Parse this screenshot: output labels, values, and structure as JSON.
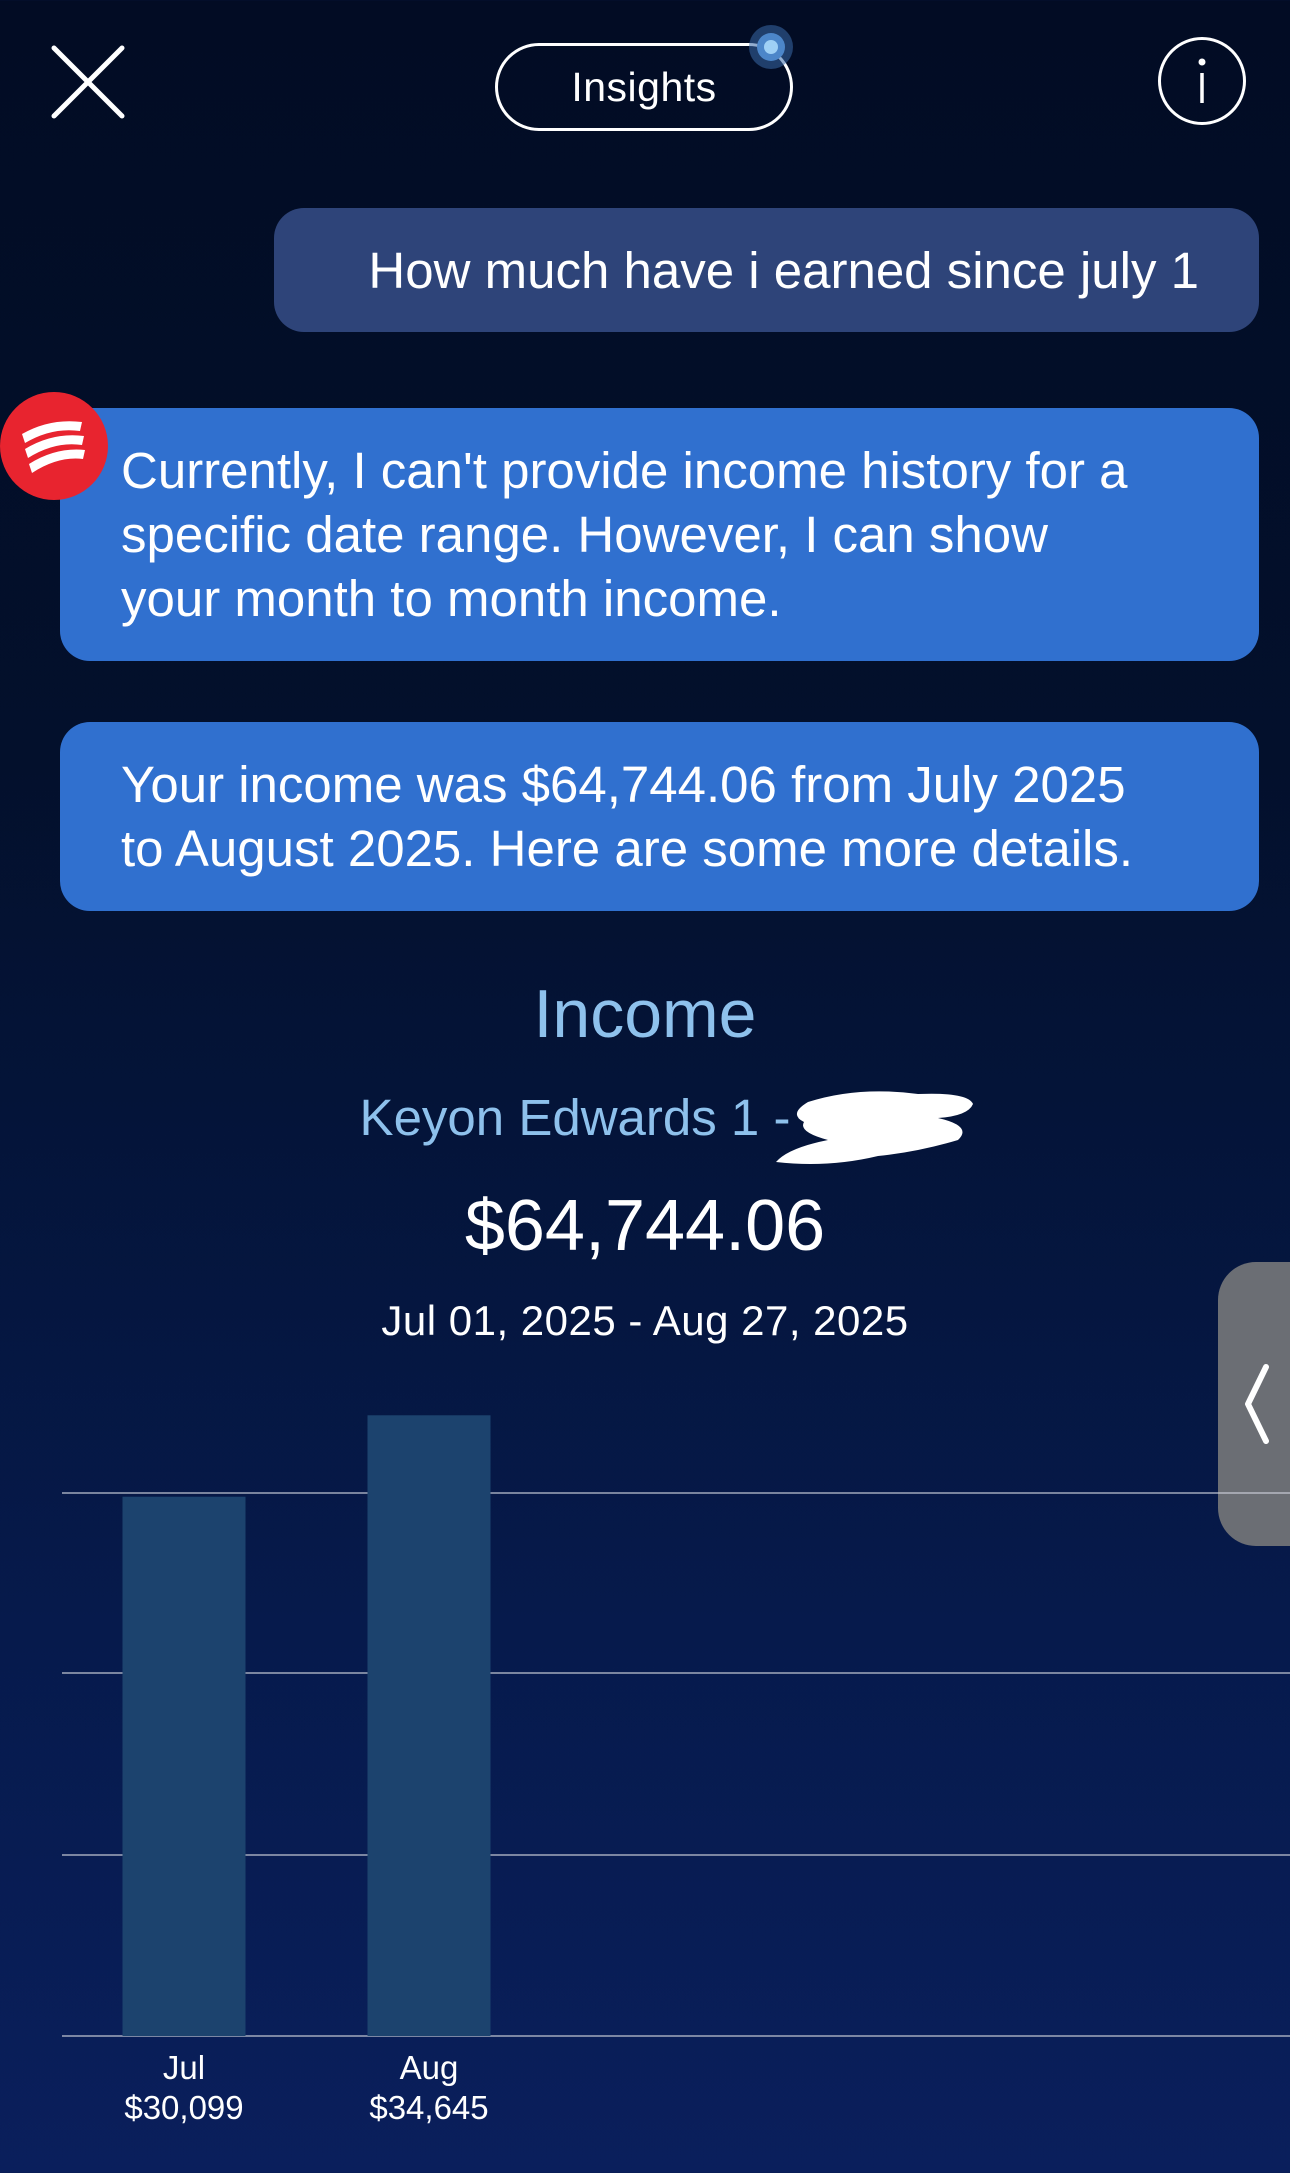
{
  "header": {
    "close_icon": "close-icon",
    "insights_label": "Insights",
    "info_icon": "info-icon"
  },
  "colors": {
    "background_top": "#020c24",
    "background_bottom": "#0a1f5c",
    "user_bubble": "#2e4479",
    "bot_bubble": "#3070cf",
    "accent_text": "#8ec1ec",
    "bar": "#1c436e",
    "gridline": "#c9ced8",
    "avatar_red": "#e8242f"
  },
  "chat": {
    "user_message": "How much have i earned since july 1",
    "bot_messages": [
      {
        "lines": [
          "Currently, I can't provide income history for a",
          "specific date range. However, I can show",
          "your month to month income."
        ]
      },
      {
        "lines": [
          "Your income was $64,744.06 from July 2025",
          "to August 2025. Here are some more details."
        ]
      }
    ],
    "bot_avatar_icon": "assistant-logo-icon"
  },
  "summary": {
    "title": "Income",
    "account": "Keyon Edwards 1 -",
    "total": "$64,744.06",
    "date_range": "Jul 01, 2025 - Aug 27, 2025"
  },
  "side_handle_icon": "chevron-left-icon",
  "chart_data": {
    "type": "bar",
    "categories": [
      "Jul",
      "Aug"
    ],
    "value_labels": [
      "$30,099",
      "$34,645"
    ],
    "values": [
      30099,
      34645
    ],
    "ylim": [
      0,
      36000
    ],
    "grid": true
  }
}
